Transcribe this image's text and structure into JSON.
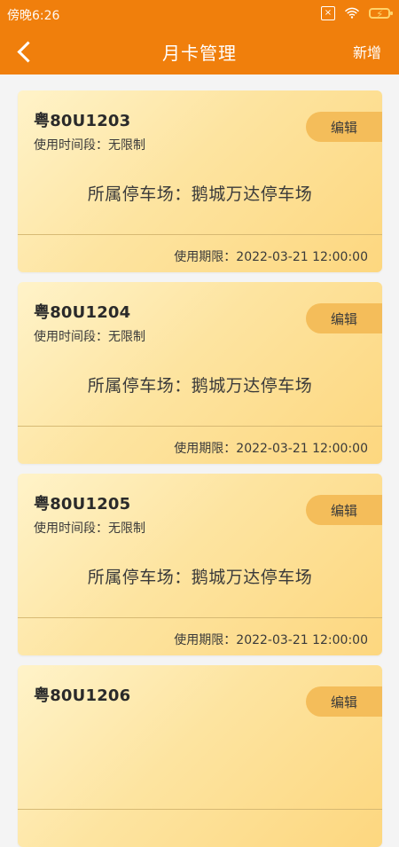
{
  "statusbar": {
    "time": "傍晚6:26",
    "sim_icon": "x-box-icon",
    "wifi_icon": "wifi-icon",
    "battery_icon": "battery-charging-icon"
  },
  "navbar": {
    "title": "月卡管理",
    "add_label": "新增",
    "back_icon": "chevron-left-icon"
  },
  "cards": [
    {
      "plate": "粤80U1203",
      "period": "使用时间段：无限制",
      "edit_label": "编辑",
      "lot": "所属停车场：鹅城万达停车场",
      "expiry": "使用期限：2022-03-21 12:00:00"
    },
    {
      "plate": "粤80U1204",
      "period": "使用时间段：无限制",
      "edit_label": "编辑",
      "lot": "所属停车场：鹅城万达停车场",
      "expiry": "使用期限：2022-03-21 12:00:00"
    },
    {
      "plate": "粤80U1205",
      "period": "使用时间段：无限制",
      "edit_label": "编辑",
      "lot": "所属停车场：鹅城万达停车场",
      "expiry": "使用期限：2022-03-21 12:00:00"
    },
    {
      "plate": "粤80U1206",
      "period": "",
      "edit_label": "编辑",
      "lot": "",
      "expiry": ""
    }
  ],
  "colors": {
    "primary": "#f07f0c",
    "card_bg_start": "#fff3c9",
    "card_bg_end": "#fdd77f",
    "edit_button": "#f4bd5a"
  }
}
